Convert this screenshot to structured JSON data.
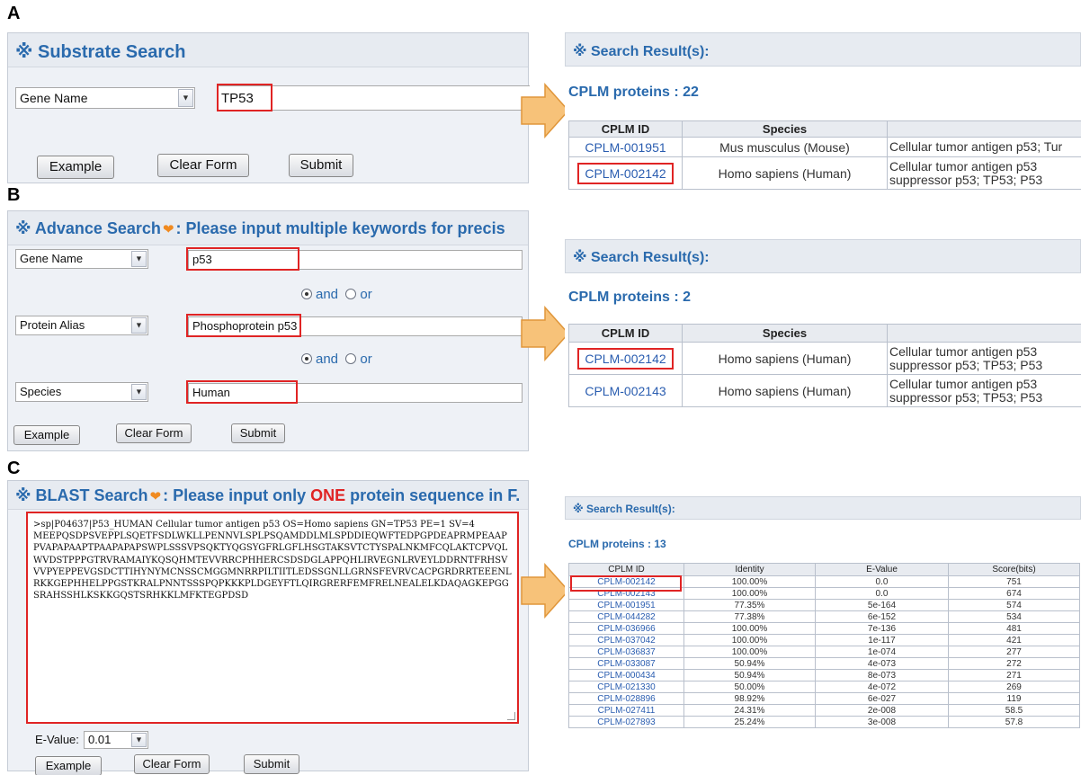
{
  "labels": {
    "a": "A",
    "b": "B",
    "c": "C"
  },
  "colors": {
    "title_blue": "#2a6aad",
    "highlight_red": "#e02424",
    "link_blue": "#2a5db0",
    "arrow_orange": "#f5b45a",
    "panel_bg": "#eef1f6"
  },
  "panelA": {
    "title": "※ Substrate Search",
    "field_select": "Gene Name",
    "query": "TP53",
    "buttons": {
      "example": "Example",
      "clear": "Clear Form",
      "submit": "Submit"
    }
  },
  "panelB": {
    "title_prefix": "※ Advance Search",
    "title_suffix": ": Please input multiple keywords for precis",
    "row1": {
      "select": "Gene Name",
      "value": "p53"
    },
    "op1": {
      "and": "and",
      "or": "or",
      "selected": "and"
    },
    "row2": {
      "select": "Protein Alias",
      "value": "Phosphoprotein p53"
    },
    "op2": {
      "and": "and",
      "or": "or",
      "selected": "and"
    },
    "row3": {
      "select": "Species",
      "value": "Human"
    },
    "buttons": {
      "example": "Example",
      "clear": "Clear Form",
      "submit": "Submit"
    }
  },
  "panelC": {
    "title_prefix": "※ BLAST Search",
    "title_mid": ": Please input only ",
    "title_one": "ONE",
    "title_suffix": " protein sequence in F.",
    "sequence": ">sp|P04637|P53_HUMAN Cellular tumor antigen p53 OS=Homo sapiens GN=TP53 PE=1 SV=4\nMEEPQSDPSVEPPLSQETFSDLWKLLPENNVLSPLPSQAMDDLMLSPDDIEQWFTEDPGPDEAPRMPEAAPPVAPAPAAPTPAAPAPAPSWPLSSSVPSQKTYQGSYGFRLGFLHSGTAKSVTCTYSPALNKMFCQLAKTCPVQLWVDSTPPPGTRVRAMAIYKQSQHMTEVVRRCPHHERCSDSDGLAPPQHLIRVEGNLRVEYLDDRNTFRHSVVVPYEPPEVGSDCTTIHYNYMCNSSCMGGMNRRPILTIITLEDSSGNLLGRNSFEVRVCACPGRDRRTEEENLRKKGEPHHELPPGSTKRALPNNTSSSPQPKKKPLDGEYFTLQIRGRERFEMFRELNEALELKDAQAGKEPGGSRAHSSHLKSKKGQSTSRHKKLMFKTEGPDSD",
    "evalue_label": "E-Value:",
    "evalue": "0.01",
    "buttons": {
      "example": "Example",
      "clear": "Clear Form",
      "submit": "Submit"
    }
  },
  "resultA": {
    "heading": "※ Search Result(s):",
    "count": "CPLM proteins : 22",
    "columns": [
      "CPLM ID",
      "Species",
      ""
    ],
    "rows": [
      {
        "id": "CPLM-001951",
        "species": "Mus musculus (Mouse)",
        "desc": "Cellular tumor antigen p53; Tur"
      },
      {
        "id": "CPLM-002142",
        "species": "Homo sapiens (Human)",
        "desc": "Cellular tumor antigen p53 suppressor p53; TP53; P53",
        "highlight": true
      }
    ]
  },
  "resultB": {
    "heading": "※ Search Result(s):",
    "count": "CPLM proteins : 2",
    "columns": [
      "CPLM ID",
      "Species",
      ""
    ],
    "rows": [
      {
        "id": "CPLM-002142",
        "species": "Homo sapiens (Human)",
        "desc": "Cellular tumor antigen p53 suppressor p53; TP53; P53",
        "highlight": true
      },
      {
        "id": "CPLM-002143",
        "species": "Homo sapiens (Human)",
        "desc": "Cellular tumor antigen p53 suppressor p53; TP53; P53"
      }
    ]
  },
  "resultC": {
    "heading": "※ Search Result(s):",
    "count": "CPLM proteins : 13",
    "columns": [
      "CPLM ID",
      "Identity",
      "E-Value",
      "Score(bits)"
    ],
    "rows": [
      [
        "CPLM-002142",
        "100.00%",
        "0.0",
        "751"
      ],
      [
        "CPLM-002143",
        "100.00%",
        "0.0",
        "674"
      ],
      [
        "CPLM-001951",
        "77.35%",
        "5e-164",
        "574"
      ],
      [
        "CPLM-044282",
        "77.38%",
        "6e-152",
        "534"
      ],
      [
        "CPLM-036966",
        "100.00%",
        "7e-136",
        "481"
      ],
      [
        "CPLM-037042",
        "100.00%",
        "1e-117",
        "421"
      ],
      [
        "CPLM-036837",
        "100.00%",
        "1e-074",
        "277"
      ],
      [
        "CPLM-033087",
        "50.94%",
        "4e-073",
        "272"
      ],
      [
        "CPLM-000434",
        "50.94%",
        "8e-073",
        "271"
      ],
      [
        "CPLM-021330",
        "50.00%",
        "4e-072",
        "269"
      ],
      [
        "CPLM-028896",
        "98.92%",
        "6e-027",
        "119"
      ],
      [
        "CPLM-027411",
        "24.31%",
        "2e-008",
        "58.5"
      ],
      [
        "CPLM-027893",
        "25.24%",
        "3e-008",
        "57.8"
      ]
    ]
  }
}
